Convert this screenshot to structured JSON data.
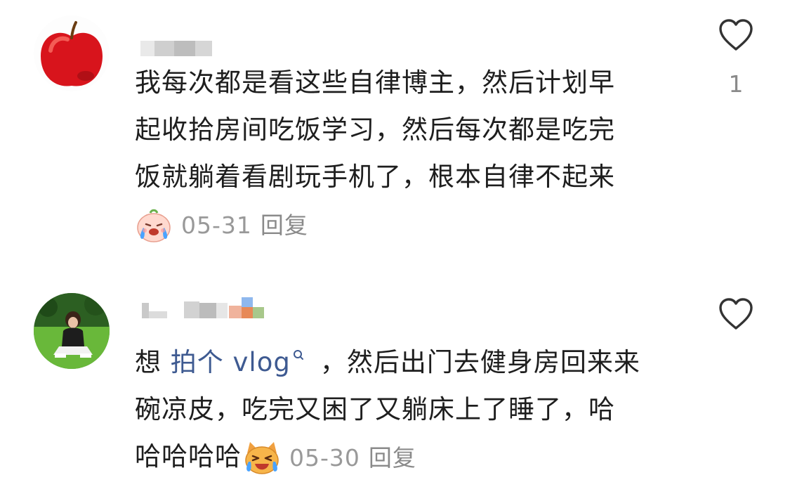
{
  "comments": [
    {
      "avatar": "red-apple-avatar",
      "lines": [
        "我每次都是看这些自律博主，然后计划早",
        "起收拾房间吃饭学习，然后每次都是吃完",
        "饭就躺着看剧玩手机了，根本自律不起来"
      ],
      "emoji": "crying-face-emoji",
      "date": "05-31",
      "reply_label": "回复",
      "like_count": "1"
    },
    {
      "avatar": "girl-on-grass-avatar",
      "prefix": "想",
      "link_text": "拍个 vlog",
      "after_link": "，然后出门去健身房回来来",
      "line2": "碗凉皮，吃完又困了又躺床上了睡了，哈",
      "line3": "哈哈哈哈",
      "emoji": "laughing-cat-emoji",
      "date": "05-30",
      "reply_label": "回复"
    }
  ],
  "icons": {
    "like": "heart-outline-icon",
    "search": "search-icon"
  },
  "colors": {
    "link": "#3e5a91",
    "meta": "#999999",
    "text": "#1e1e1e"
  }
}
